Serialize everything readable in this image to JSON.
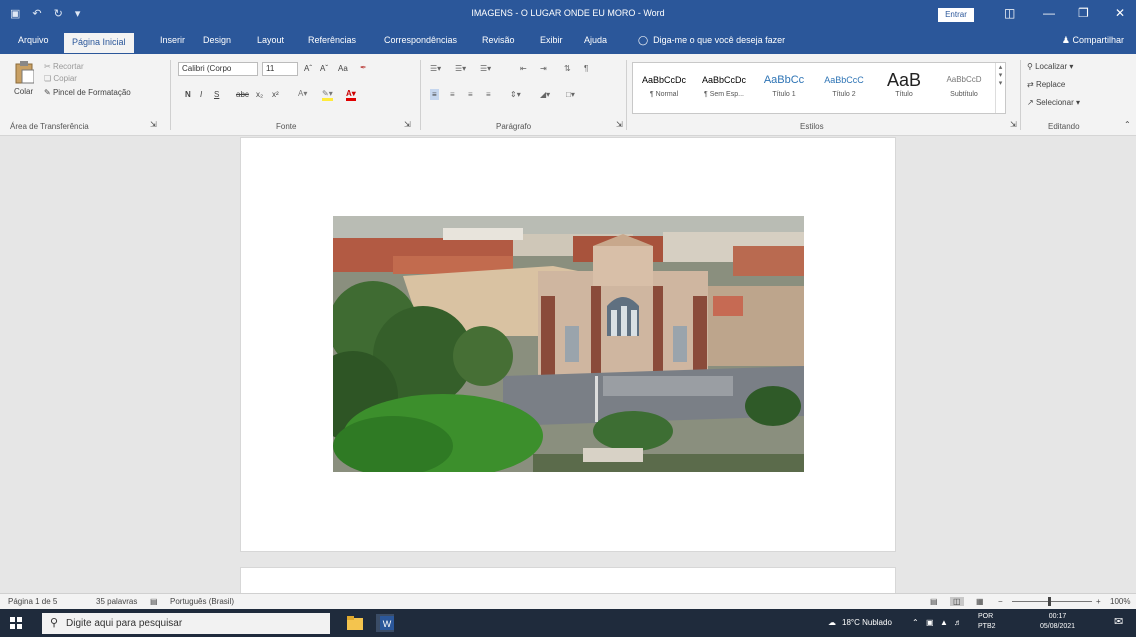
{
  "window": {
    "title": "IMAGENS - O LUGAR ONDE EU MORO  -  Word",
    "enter_label": "Entrar"
  },
  "tabs": {
    "items": [
      "Arquivo",
      "Página Inicial",
      "Inserir",
      "Design",
      "Layout",
      "Referências",
      "Correspondências",
      "Revisão",
      "Exibir",
      "Ajuda"
    ],
    "active_index": 1,
    "tell_me": "Diga-me o que você deseja fazer",
    "share": "Compartilhar"
  },
  "ribbon": {
    "clipboard": {
      "paste": "Colar",
      "cut": "Recortar",
      "copy": "Copiar",
      "format_painter": "Pincel de Formatação",
      "label": "Área de Transferência"
    },
    "font": {
      "family": "Calibri (Corpo",
      "size": "11",
      "case": "Aa",
      "bold": "N",
      "italic": "I",
      "underline": "S",
      "strike": "abc",
      "sub": "x₂",
      "sup": "x²",
      "label": "Fonte"
    },
    "paragraph": {
      "label": "Parágrafo"
    },
    "styles": {
      "items": [
        {
          "preview": "AaBbCcDc",
          "name": "¶ Normal"
        },
        {
          "preview": "AaBbCcDc",
          "name": "¶ Sem Esp..."
        },
        {
          "preview": "AaBbCc",
          "name": "Título 1"
        },
        {
          "preview": "AaBbCcC",
          "name": "Título 2"
        },
        {
          "preview": "AaB",
          "name": "Título"
        },
        {
          "preview": "AaBbCcD",
          "name": "Subtítulo"
        }
      ],
      "label": "Estilos"
    },
    "editing": {
      "find": "Localizar",
      "replace": "Replace",
      "select": "Selecionar",
      "label": "Editando"
    }
  },
  "status": {
    "page": "Página 1 de 5",
    "words": "35 palavras",
    "language": "Português (Brasil)",
    "zoom": "100%"
  },
  "taskbar": {
    "search_placeholder": "Digite aqui para pesquisar",
    "weather": "18°C  Nublado",
    "lang": "POR",
    "lang2": "PTB2",
    "time": "00:17",
    "date": "05/08/2021"
  }
}
